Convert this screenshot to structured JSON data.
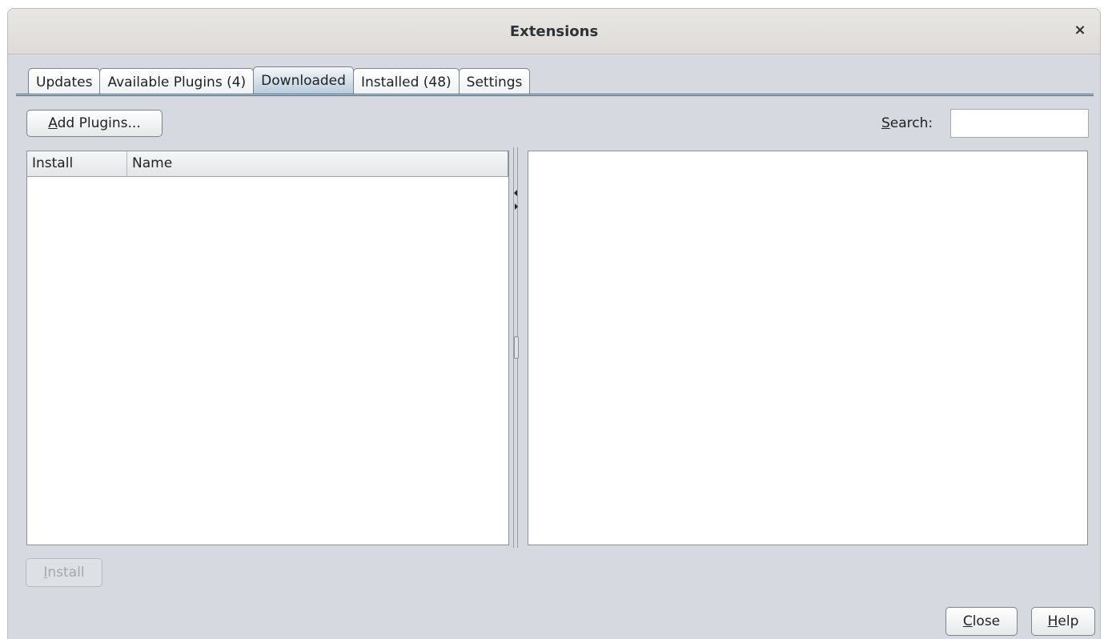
{
  "window": {
    "title": "Extensions",
    "close_glyph": "×"
  },
  "tabs": [
    {
      "label": "Updates",
      "active": false
    },
    {
      "label": "Available Plugins (4)",
      "active": false
    },
    {
      "label": "Downloaded",
      "active": true
    },
    {
      "label": "Installed (48)",
      "active": false
    },
    {
      "label": "Settings",
      "active": false
    }
  ],
  "toolbar": {
    "add_plugins": {
      "mnemonic": "A",
      "rest": "dd Plugins..."
    }
  },
  "search": {
    "label_mnemonic": "S",
    "label_rest": "earch:",
    "value": "",
    "placeholder": ""
  },
  "table": {
    "columns": [
      "Install",
      "Name"
    ],
    "rows": []
  },
  "buttons": {
    "install": {
      "mnemonic": "I",
      "rest": "nstall",
      "enabled": false
    },
    "close": {
      "mnemonic": "C",
      "rest": "lose"
    },
    "help": {
      "mnemonic": "H",
      "rest": "elp"
    }
  },
  "icons": {
    "close": "close-icon",
    "collapse_left": "arrow-left-icon",
    "expand_right": "arrow-right-icon",
    "splitter_grip": "grip-icon"
  },
  "colors": {
    "window_bg": "#d6d9df",
    "active_tab": "#b8cbdc",
    "tab_underline": "#3d5a75"
  }
}
